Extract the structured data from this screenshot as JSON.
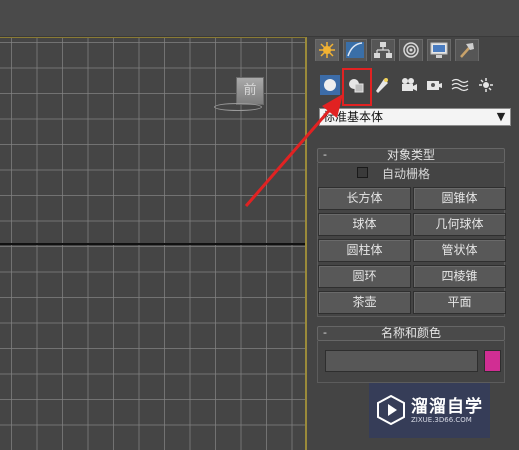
{
  "viewport": {
    "viewcube_label": "前"
  },
  "command_panel": {
    "tabs": [
      {
        "icon": "create-tab-icon"
      },
      {
        "icon": "modify-tab-icon"
      },
      {
        "icon": "hierarchy-tab-icon"
      },
      {
        "icon": "motion-tab-icon"
      },
      {
        "icon": "display-tab-icon"
      },
      {
        "icon": "utilities-tab-icon"
      }
    ],
    "create_categories": [
      {
        "icon": "geometry-icon"
      },
      {
        "icon": "shapes-icon"
      },
      {
        "icon": "lights-icon"
      },
      {
        "icon": "cameras-icon"
      },
      {
        "icon": "helpers-icon"
      },
      {
        "icon": "space-warps-icon"
      },
      {
        "icon": "systems-icon"
      }
    ],
    "dropdown_value": "标准基本体",
    "object_type": {
      "title": "对象类型",
      "collapse": "-",
      "autogrid_label": "自动栅格",
      "buttons": [
        "长方体",
        "圆锥体",
        "球体",
        "几何球体",
        "圆柱体",
        "管状体",
        "圆环",
        "四棱锥",
        "茶壶",
        "平面"
      ]
    },
    "name_color": {
      "title": "名称和颜色",
      "collapse": "-",
      "name_value": "",
      "color": "#d12e93"
    }
  },
  "annotation": {
    "highlight_color": "#e12222"
  },
  "watermark": {
    "title": "溜溜自学",
    "url": "ZIXUE.3D66.COM"
  }
}
